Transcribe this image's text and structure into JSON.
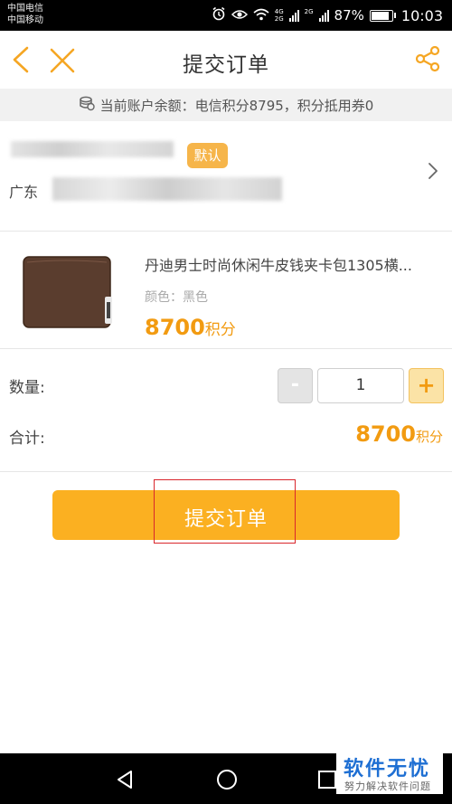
{
  "status_bar": {
    "carrier_1": "中国电信",
    "carrier_2": "中国移动",
    "net_1": "4G",
    "net_2": "2G",
    "battery": "87%",
    "time": "10:03"
  },
  "header": {
    "title": "提交订单",
    "back_icon": "chevron-left-icon",
    "close_icon": "close-icon",
    "share_icon": "share-icon"
  },
  "balance": {
    "text": "当前账户余额：电信积分8795，积分抵用券0"
  },
  "address": {
    "default_badge": "默认",
    "prefix": "广东"
  },
  "product": {
    "name": "丹迪男士时尚休闲牛皮钱夹卡包1305横...",
    "color": "颜色：黑色",
    "price": "8700",
    "unit": "积分"
  },
  "quantity": {
    "label": "数量:",
    "value": "1",
    "minus": "-",
    "plus": "+"
  },
  "total": {
    "label": "合计:",
    "value": "8700",
    "unit": "积分"
  },
  "submit": {
    "label": "提交订单"
  },
  "watermark": {
    "main": "软件无忧",
    "sub": "努力解决软件问题"
  },
  "colors": {
    "accent": "#fbb021",
    "price": "#f29b11",
    "highlight_box": "#d9262c"
  }
}
